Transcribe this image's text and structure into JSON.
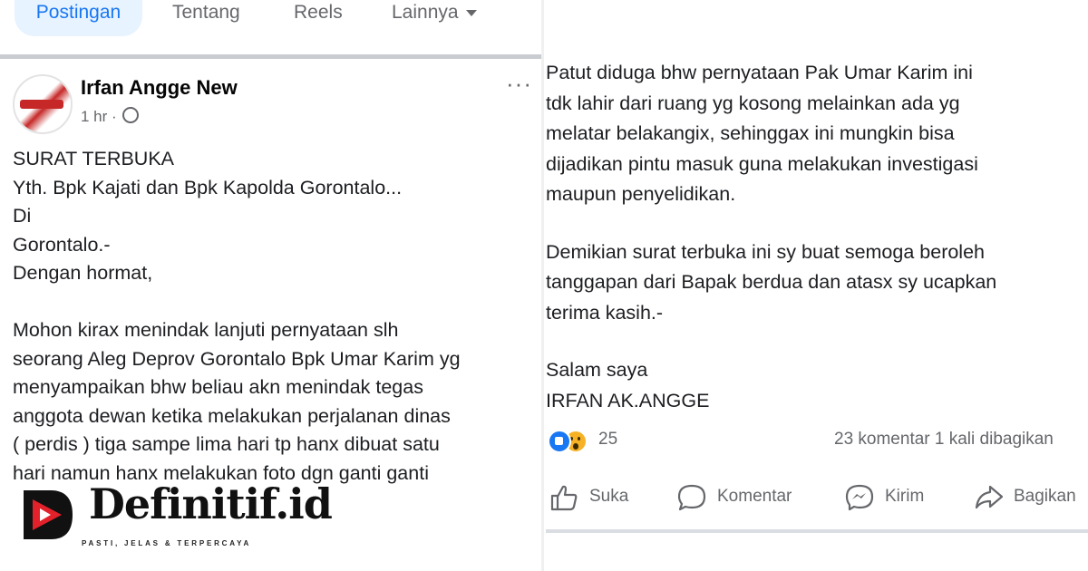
{
  "profile_tabs": {
    "active": "Postingan",
    "tentang": "Tentang",
    "reels": "Reels",
    "lainnya": "Lainnya"
  },
  "post": {
    "author": "Irfan Angge New",
    "time": "1 hr ·",
    "more": "···",
    "body_left": [
      "SURAT TERBUKA",
      "Yth. Bpk Kajati dan Bpk Kapolda Gorontalo...",
      "Di",
      "Gorontalo.-",
      "Dengan hormat,",
      "",
      "Mohon kirax menindak lanjuti pernyataan slh",
      "seorang Aleg Deprov Gorontalo Bpk Umar Karim yg",
      "menyampaikan bhw beliau akn menindak tegas",
      "anggota dewan ketika melakukan perjalanan dinas",
      "( perdis ) tiga sampe lima hari tp hanx dibuat satu",
      "hari namun hanx melakukan foto dgn ganti ganti"
    ],
    "body_right": [
      "Patut diduga bhw pernyataan Pak Umar Karim ini",
      "tdk lahir dari ruang yg kosong melainkan ada yg",
      "melatar belakangix, sehinggax ini mungkin bisa",
      "dijadikan pintu masuk guna melakukan investigasi",
      "maupun penyelidikan.",
      "",
      "Demikian surat terbuka ini sy buat  semoga beroleh",
      "tanggapan dari Bapak berdua dan atasx sy ucapkan",
      "terima kasih.-",
      "",
      "Salam saya",
      "IRFAN AK.ANGGE"
    ],
    "reaction_count": "25",
    "comments_shares": "23 komentar  1 kali dibagikan",
    "actions": {
      "like": "Suka",
      "comment": "Komentar",
      "send": "Kirim",
      "share": "Bagikan"
    }
  },
  "watermark": {
    "brand": "Definitif.id",
    "tagline": "PASTI, JELAS & TERPERCAYA"
  },
  "colors": {
    "accent": "#1877f2",
    "tab_active_bg": "#e7f3ff",
    "muted": "#65676b",
    "logo_red": "#e3212a"
  }
}
